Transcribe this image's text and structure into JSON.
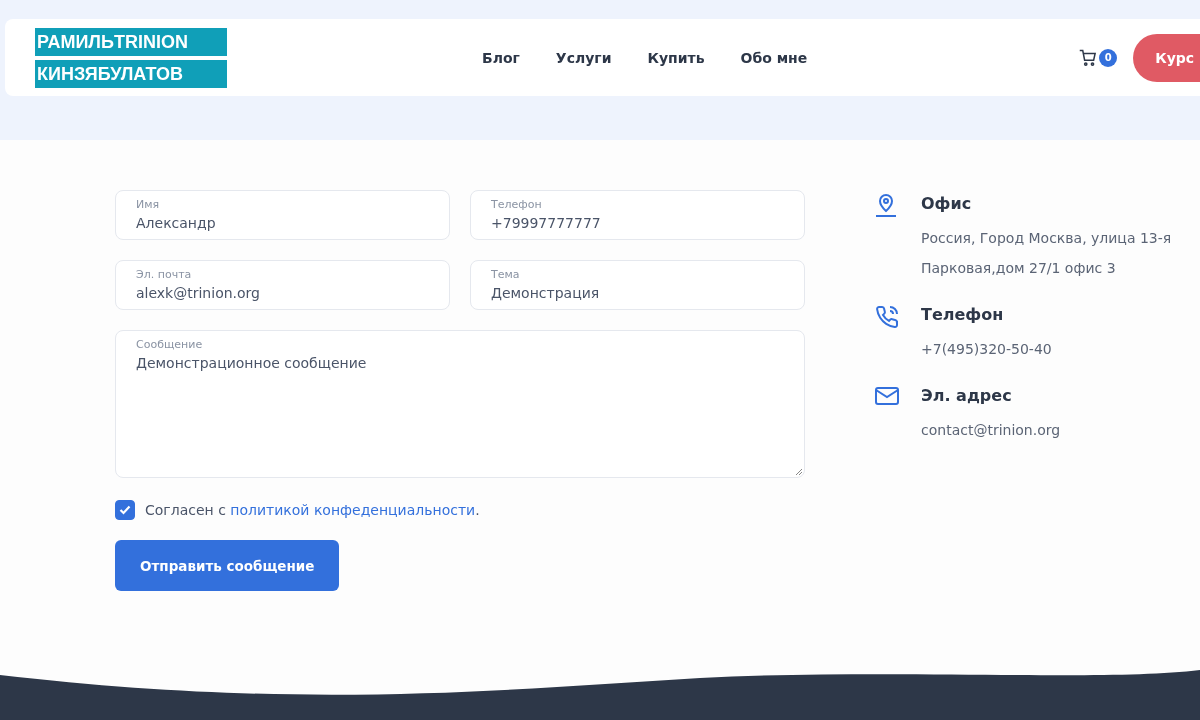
{
  "logo": {
    "top": "РАМИЛЬ",
    "brand": "TRINION",
    "bottom": "КИНЗЯБУЛАТОВ"
  },
  "nav": [
    "Блог",
    "Услуги",
    "Купить",
    "Обо мне"
  ],
  "cart": {
    "count": "0"
  },
  "cta": "Курс",
  "form": {
    "fields": [
      {
        "label": "Имя",
        "value": "Александр",
        "kind": "input"
      },
      {
        "label": "Телефон",
        "value": "+79997777777",
        "kind": "input"
      },
      {
        "label": "Эл. почта",
        "value": "alexk@trinion.org",
        "kind": "input"
      },
      {
        "label": "Тема",
        "value": "Демонстрация",
        "kind": "input"
      },
      {
        "label": "Сообщение",
        "value": "Демонстрационное сообщение",
        "kind": "textarea"
      }
    ],
    "consent": {
      "checked": true,
      "prefix": "Согласен с ",
      "link": "политикой конфеденциальности",
      "suffix": "."
    },
    "submit": "Отправить сообщение"
  },
  "contacts": [
    {
      "kind": "office",
      "title": "Офис",
      "lines": [
        "Россия, Город Москва, улица 13-я",
        "Парковая,дом 27/1 офис 3"
      ]
    },
    {
      "kind": "phone",
      "title": "Телефон",
      "lines": [
        "+7(495)320-50-40"
      ]
    },
    {
      "kind": "email",
      "title": "Эл. адрес",
      "lines": [
        "contact@trinion.org"
      ]
    }
  ]
}
